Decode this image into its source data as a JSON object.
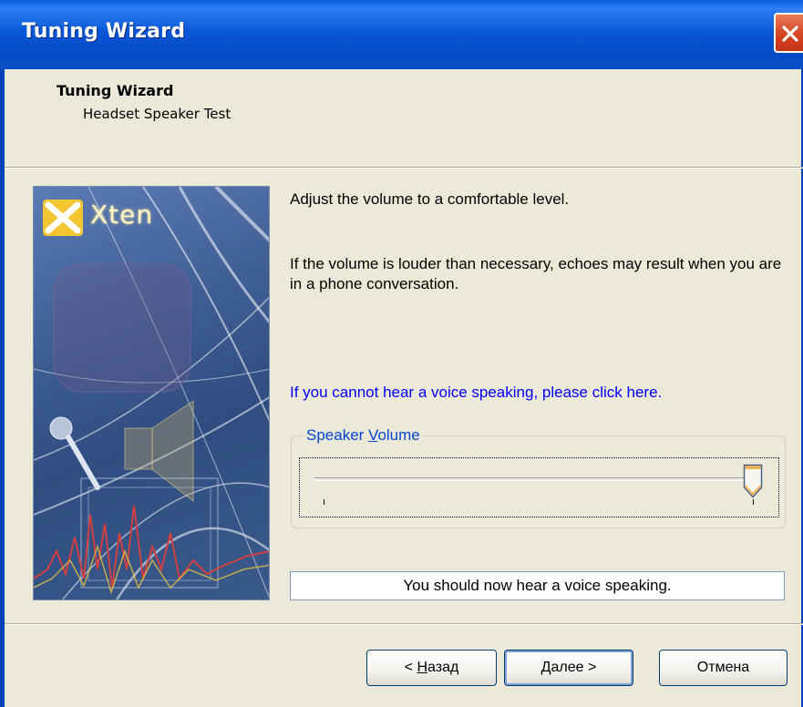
{
  "window": {
    "title": "Tuning Wizard"
  },
  "header": {
    "title": "Tuning Wizard",
    "subtitle": "Headset Speaker Test"
  },
  "graphic": {
    "logo_text": "Xten"
  },
  "content": {
    "instruction": "Adjust the volume to a comfortable level.",
    "warning": "If the volume is louder than necessary, echoes may result when you are in a phone conversation.",
    "help_link": "If you cannot hear a voice speaking, please click here."
  },
  "speaker_volume": {
    "label_prefix": "Speaker ",
    "label_accel": "V",
    "label_suffix": "olume",
    "level_fraction": 1.0
  },
  "status": {
    "message": "You should now hear a voice speaking."
  },
  "buttons": {
    "back_prefix": "< ",
    "back_accel": "Н",
    "back_suffix": "азад",
    "next_accel": "Д",
    "next_suffix": "алее >",
    "cancel": "Отмена"
  },
  "colors": {
    "titlebar": "#0a58d8",
    "link": "#0000ff",
    "groupbox_label": "#0046d5",
    "close_button": "#d4401d"
  }
}
